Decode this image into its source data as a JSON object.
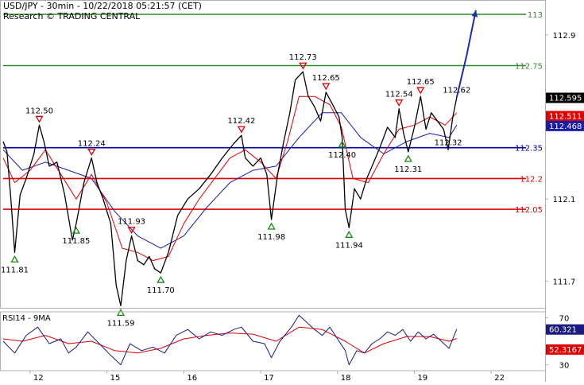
{
  "header": {
    "title": "USD/JPY - 30min - 10/22/2018 05:21:57 (CET)",
    "source": "Research © TRADING CENTRAL"
  },
  "colors": {
    "price": "#000000",
    "ma_fast": "#e00000",
    "ma_slow": "#1a1aa8",
    "resistance": "#2e8b2e",
    "pivot": "#0000a0",
    "support": "#e00000",
    "projection": "#1a2faa",
    "rsi": "#1a1a80",
    "rsi_ma": "#e00000",
    "frame": "#b0b0b0"
  },
  "chart_data": [
    {
      "type": "line",
      "name": "price",
      "ylim": [
        111.5,
        113.0
      ],
      "y_ticks": [
        112.9,
        112.1,
        111.7
      ],
      "x_ticks": [
        {
          "label": "12",
          "x": 0.5
        },
        {
          "label": "15",
          "x": 1.5
        },
        {
          "label": "16",
          "x": 2.5
        },
        {
          "label": "17",
          "x": 3.5
        },
        {
          "label": "18",
          "x": 4.5
        },
        {
          "label": "19",
          "x": 5.5
        },
        {
          "label": "22",
          "x": 6.5
        }
      ],
      "xlim": [
        0.15,
        7.2
      ],
      "price_path": [
        [
          0.15,
          112.38
        ],
        [
          0.2,
          112.33
        ],
        [
          0.25,
          112.1
        ],
        [
          0.3,
          111.84
        ],
        [
          0.37,
          112.12
        ],
        [
          0.45,
          112.2
        ],
        [
          0.55,
          112.32
        ],
        [
          0.62,
          112.46
        ],
        [
          0.68,
          112.38
        ],
        [
          0.75,
          112.26
        ],
        [
          0.85,
          112.28
        ],
        [
          0.95,
          112.12
        ],
        [
          1.05,
          111.9
        ],
        [
          1.1,
          111.98
        ],
        [
          1.2,
          112.18
        ],
        [
          1.3,
          112.3
        ],
        [
          1.37,
          112.18
        ],
        [
          1.45,
          112.1
        ],
        [
          1.55,
          111.98
        ],
        [
          1.62,
          111.68
        ],
        [
          1.68,
          111.58
        ],
        [
          1.75,
          111.8
        ],
        [
          1.82,
          111.92
        ],
        [
          1.9,
          111.8
        ],
        [
          1.98,
          111.78
        ],
        [
          2.05,
          111.82
        ],
        [
          2.12,
          111.76
        ],
        [
          2.2,
          111.74
        ],
        [
          2.3,
          111.84
        ],
        [
          2.42,
          112.02
        ],
        [
          2.55,
          112.1
        ],
        [
          2.7,
          112.15
        ],
        [
          2.85,
          112.22
        ],
        [
          3.0,
          112.3
        ],
        [
          3.15,
          112.37
        ],
        [
          3.25,
          112.41
        ],
        [
          3.3,
          112.3
        ],
        [
          3.4,
          112.26
        ],
        [
          3.5,
          112.3
        ],
        [
          3.58,
          112.22
        ],
        [
          3.64,
          112.0
        ],
        [
          3.72,
          112.22
        ],
        [
          3.8,
          112.38
        ],
        [
          3.88,
          112.52
        ],
        [
          3.95,
          112.68
        ],
        [
          4.05,
          112.72
        ],
        [
          4.12,
          112.6
        ],
        [
          4.2,
          112.55
        ],
        [
          4.28,
          112.48
        ],
        [
          4.35,
          112.62
        ],
        [
          4.45,
          112.55
        ],
        [
          4.52,
          112.5
        ],
        [
          4.56,
          112.4
        ],
        [
          4.6,
          112.05
        ],
        [
          4.65,
          111.96
        ],
        [
          4.72,
          112.15
        ],
        [
          4.8,
          112.1
        ],
        [
          4.88,
          112.2
        ],
        [
          4.95,
          112.26
        ],
        [
          5.05,
          112.35
        ],
        [
          5.15,
          112.45
        ],
        [
          5.25,
          112.4
        ],
        [
          5.3,
          112.54
        ],
        [
          5.36,
          112.42
        ],
        [
          5.42,
          112.33
        ],
        [
          5.5,
          112.45
        ],
        [
          5.58,
          112.6
        ],
        [
          5.65,
          112.44
        ],
        [
          5.72,
          112.52
        ],
        [
          5.8,
          112.48
        ],
        [
          5.88,
          112.44
        ],
        [
          5.94,
          112.34
        ],
        [
          6.0,
          112.5
        ],
        [
          6.05,
          112.595
        ]
      ],
      "ma_fast_path": [
        [
          0.15,
          112.3
        ],
        [
          0.3,
          112.18
        ],
        [
          0.5,
          112.24
        ],
        [
          0.7,
          112.34
        ],
        [
          0.9,
          112.22
        ],
        [
          1.1,
          112.1
        ],
        [
          1.3,
          112.22
        ],
        [
          1.5,
          112.08
        ],
        [
          1.7,
          111.86
        ],
        [
          1.9,
          111.84
        ],
        [
          2.1,
          111.8
        ],
        [
          2.3,
          111.82
        ],
        [
          2.5,
          111.98
        ],
        [
          2.7,
          112.1
        ],
        [
          2.9,
          112.2
        ],
        [
          3.1,
          112.3
        ],
        [
          3.3,
          112.34
        ],
        [
          3.5,
          112.28
        ],
        [
          3.7,
          112.2
        ],
        [
          3.85,
          112.38
        ],
        [
          4.0,
          112.6
        ],
        [
          4.2,
          112.6
        ],
        [
          4.4,
          112.56
        ],
        [
          4.55,
          112.45
        ],
        [
          4.7,
          112.2
        ],
        [
          4.9,
          112.18
        ],
        [
          5.1,
          112.32
        ],
        [
          5.3,
          112.44
        ],
        [
          5.5,
          112.46
        ],
        [
          5.7,
          112.5
        ],
        [
          5.9,
          112.46
        ],
        [
          6.05,
          112.52
        ]
      ],
      "ma_slow_path": [
        [
          0.15,
          112.34
        ],
        [
          0.4,
          112.24
        ],
        [
          0.7,
          112.28
        ],
        [
          1.0,
          112.24
        ],
        [
          1.3,
          112.2
        ],
        [
          1.6,
          112.04
        ],
        [
          1.9,
          111.92
        ],
        [
          2.2,
          111.86
        ],
        [
          2.5,
          111.92
        ],
        [
          2.8,
          112.06
        ],
        [
          3.1,
          112.18
        ],
        [
          3.4,
          112.24
        ],
        [
          3.7,
          112.26
        ],
        [
          4.0,
          112.4
        ],
        [
          4.3,
          112.52
        ],
        [
          4.55,
          112.52
        ],
        [
          4.8,
          112.4
        ],
        [
          5.1,
          112.32
        ],
        [
          5.4,
          112.38
        ],
        [
          5.7,
          112.42
        ],
        [
          5.95,
          112.4
        ],
        [
          6.05,
          112.46
        ]
      ],
      "projection": [
        [
          6.05,
          112.595
        ],
        [
          6.18,
          112.8
        ],
        [
          6.3,
          113.02
        ]
      ],
      "levels": [
        {
          "name": "113",
          "value": 113.0,
          "kind": "resistance"
        },
        {
          "name": "112.75",
          "value": 112.75,
          "kind": "resistance"
        },
        {
          "name": "112.35",
          "value": 112.35,
          "kind": "pivot"
        },
        {
          "name": "112.2",
          "value": 112.2,
          "kind": "support"
        },
        {
          "name": "112.05",
          "value": 112.05,
          "kind": "support"
        }
      ],
      "markers": [
        {
          "label": "112.50",
          "x": 0.62,
          "y": 112.46,
          "dir": "down"
        },
        {
          "label": "111.81",
          "x": 0.3,
          "y": 111.84,
          "dir": "up"
        },
        {
          "label": "112.24",
          "x": 1.3,
          "y": 112.3,
          "dir": "down"
        },
        {
          "label": "111.85",
          "x": 1.1,
          "y": 111.98,
          "dir": "up"
        },
        {
          "label": "111.93",
          "x": 1.82,
          "y": 111.92,
          "dir": "down"
        },
        {
          "label": "111.59",
          "x": 1.68,
          "y": 111.58,
          "dir": "up"
        },
        {
          "label": "111.70",
          "x": 2.2,
          "y": 111.74,
          "dir": "up"
        },
        {
          "label": "112.42",
          "x": 3.25,
          "y": 112.41,
          "dir": "down"
        },
        {
          "label": "111.98",
          "x": 3.64,
          "y": 112.0,
          "dir": "up"
        },
        {
          "label": "112.73",
          "x": 4.05,
          "y": 112.72,
          "dir": "down"
        },
        {
          "label": "112.65",
          "x": 4.35,
          "y": 112.62,
          "dir": "down"
        },
        {
          "label": "112.40",
          "x": 4.56,
          "y": 112.4,
          "dir": "up"
        },
        {
          "label": "111.94",
          "x": 4.65,
          "y": 111.96,
          "dir": "up"
        },
        {
          "label": "112.54",
          "x": 5.3,
          "y": 112.54,
          "dir": "down"
        },
        {
          "label": "112.65",
          "x": 5.58,
          "y": 112.6,
          "dir": "down"
        },
        {
          "label": "112.31",
          "x": 5.42,
          "y": 112.33,
          "dir": "up"
        },
        {
          "label": "112.32",
          "x": 5.94,
          "y": 112.34,
          "dir": "none"
        },
        {
          "label": "112.62",
          "x": 6.05,
          "y": 112.595,
          "dir": "none"
        }
      ],
      "last_price": {
        "label": "112.595",
        "value": 112.595
      },
      "ma_fast_last": {
        "label": "112.511",
        "value": 112.511
      },
      "ma_slow_last": {
        "label": "112.468",
        "value": 112.468
      }
    },
    {
      "type": "line",
      "title": "RSI14 - 9MA",
      "ylim": [
        25,
        75
      ],
      "y_ticks": [
        70,
        30
      ],
      "rsi_path": [
        [
          0.15,
          50
        ],
        [
          0.3,
          40
        ],
        [
          0.45,
          55
        ],
        [
          0.6,
          62
        ],
        [
          0.75,
          48
        ],
        [
          0.9,
          52
        ],
        [
          1.0,
          40
        ],
        [
          1.1,
          45
        ],
        [
          1.25,
          58
        ],
        [
          1.4,
          48
        ],
        [
          1.55,
          38
        ],
        [
          1.68,
          30
        ],
        [
          1.8,
          48
        ],
        [
          1.95,
          42
        ],
        [
          2.1,
          45
        ],
        [
          2.25,
          40
        ],
        [
          2.4,
          55
        ],
        [
          2.55,
          60
        ],
        [
          2.7,
          52
        ],
        [
          2.85,
          58
        ],
        [
          3.0,
          55
        ],
        [
          3.15,
          60
        ],
        [
          3.25,
          62
        ],
        [
          3.4,
          50
        ],
        [
          3.55,
          48
        ],
        [
          3.64,
          36
        ],
        [
          3.75,
          50
        ],
        [
          3.9,
          62
        ],
        [
          4.0,
          72
        ],
        [
          4.1,
          66
        ],
        [
          4.2,
          60
        ],
        [
          4.3,
          55
        ],
        [
          4.4,
          62
        ],
        [
          4.5,
          52
        ],
        [
          4.6,
          42
        ],
        [
          4.65,
          30
        ],
        [
          4.75,
          42
        ],
        [
          4.85,
          40
        ],
        [
          4.95,
          48
        ],
        [
          5.05,
          52
        ],
        [
          5.15,
          58
        ],
        [
          5.25,
          55
        ],
        [
          5.35,
          60
        ],
        [
          5.45,
          50
        ],
        [
          5.55,
          58
        ],
        [
          5.65,
          52
        ],
        [
          5.75,
          56
        ],
        [
          5.85,
          50
        ],
        [
          5.95,
          44
        ],
        [
          6.05,
          60.3
        ]
      ],
      "rsi_ma_path": [
        [
          0.15,
          52
        ],
        [
          0.4,
          50
        ],
        [
          0.7,
          55
        ],
        [
          1.0,
          48
        ],
        [
          1.3,
          50
        ],
        [
          1.6,
          42
        ],
        [
          1.9,
          40
        ],
        [
          2.2,
          44
        ],
        [
          2.5,
          52
        ],
        [
          2.8,
          55
        ],
        [
          3.1,
          57
        ],
        [
          3.4,
          56
        ],
        [
          3.7,
          50
        ],
        [
          4.0,
          62
        ],
        [
          4.3,
          60
        ],
        [
          4.6,
          50
        ],
        [
          4.85,
          40
        ],
        [
          5.1,
          48
        ],
        [
          5.4,
          54
        ],
        [
          5.7,
          54
        ],
        [
          5.95,
          50
        ],
        [
          6.05,
          52.3
        ]
      ],
      "rsi_last": {
        "label": "60.321",
        "value": 60.321
      },
      "rsi_ma_last": {
        "label": "52.3167",
        "value": 52.3167
      }
    }
  ]
}
